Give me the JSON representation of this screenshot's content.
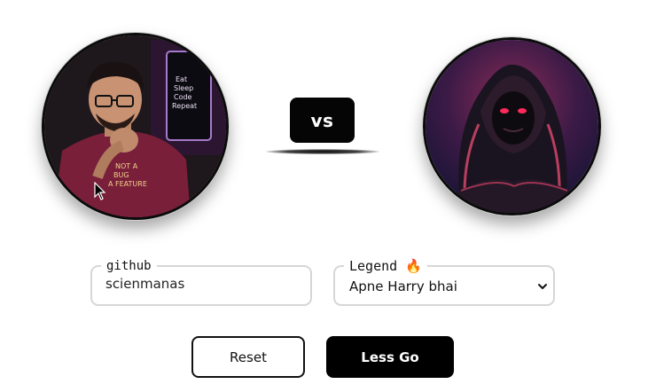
{
  "vs": {
    "label": "vs"
  },
  "github_field": {
    "label": "github",
    "value": "scienmanas"
  },
  "legend_field": {
    "label": "Legend 🔥",
    "selected": "Apne Harry bhai"
  },
  "buttons": {
    "reset": "Reset",
    "submit": "Less Go"
  },
  "avatars": {
    "left_shirt_text": "NOT A BUG A FEATURE",
    "left_poster_text": "Eat Sleep Code Repeat"
  },
  "colors": {
    "primary": "#000000",
    "border": "#d6d6d6"
  }
}
